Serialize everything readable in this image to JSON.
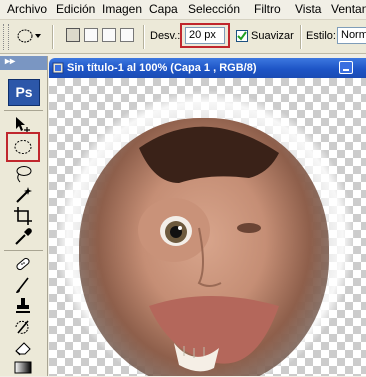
{
  "menu": [
    "Archivo",
    "Edición",
    "Imagen",
    "Capa",
    "Selección",
    "Filtro",
    "Vista",
    "Ventana"
  ],
  "options": {
    "feather_label": "Desv.:",
    "feather_value": "20 px",
    "smooth_label": "Suavizar",
    "smooth_checked": true,
    "style_label": "Estilo:",
    "style_value": "Norm"
  },
  "toolbox": {
    "logo": "Ps",
    "tools": [
      "move-tool-icon",
      "elliptical-marquee-icon",
      "lasso-icon",
      "magic-wand-icon",
      "crop-icon",
      "eyedropper-icon",
      "healing-brush-icon",
      "brush-icon",
      "clone-stamp-icon",
      "history-brush-icon",
      "eraser-icon",
      "gradient-icon"
    ]
  },
  "document": {
    "title": "Sin título-1 al 100% (Capa 1 , RGB/8)"
  },
  "colors": {
    "highlight": "#c0272d",
    "titlebar": "#1e55c6"
  }
}
